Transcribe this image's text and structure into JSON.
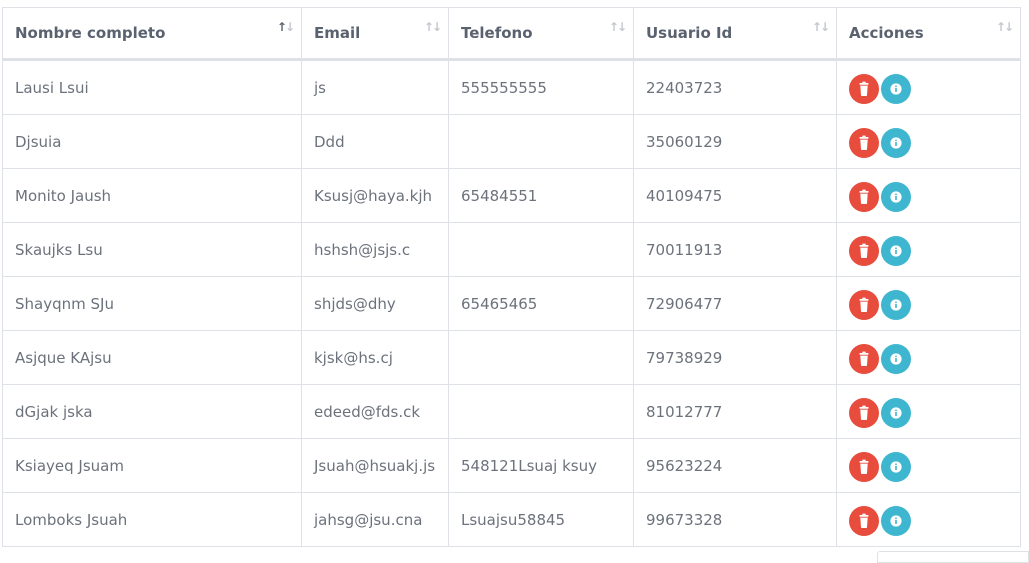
{
  "table": {
    "columns": [
      "Nombre completo",
      "Email",
      "Telefono",
      "Usuario Id",
      "Acciones"
    ],
    "rows": [
      {
        "nombre": "Lausi Lsui",
        "email": "js",
        "telefono": "555555555",
        "usuario_id": "22403723"
      },
      {
        "nombre": "Djsuia",
        "email": "Ddd",
        "telefono": "",
        "usuario_id": "35060129"
      },
      {
        "nombre": "Monito Jaush",
        "email": "Ksusj@haya.kjh",
        "telefono": "65484551",
        "usuario_id": "40109475"
      },
      {
        "nombre": "Skaujks Lsu",
        "email": "hshsh@jsjs.c",
        "telefono": "",
        "usuario_id": "70011913"
      },
      {
        "nombre": "Shayqnm SJu",
        "email": "shjds@dhy",
        "telefono": "65465465",
        "usuario_id": "72906477"
      },
      {
        "nombre": "Asjque KAjsu",
        "email": "kjsk@hs.cj",
        "telefono": "",
        "usuario_id": "79738929"
      },
      {
        "nombre": "dGjak jska",
        "email": "edeed@fds.ck",
        "telefono": "",
        "usuario_id": "81012777"
      },
      {
        "nombre": "Ksiayeq Jsuam",
        "email": "Jsuah@hsuakj.js",
        "telefono": "548121Lsuaj ksuy",
        "usuario_id": "95623224"
      },
      {
        "nombre": "Lomboks Jsuah",
        "email": "jahsg@jsu.cna",
        "telefono": "Lsuajsu58845",
        "usuario_id": "99673328"
      }
    ],
    "actions": {
      "delete_icon": "trash-icon",
      "info_icon": "info-icon"
    },
    "sort_icon": "sort-arrows-icon",
    "colors": {
      "delete": "#e74c3c",
      "info": "#3fb6cf",
      "header_text": "#5a6270",
      "cell_text": "#6c727c",
      "border": "#dee2e6"
    }
  }
}
